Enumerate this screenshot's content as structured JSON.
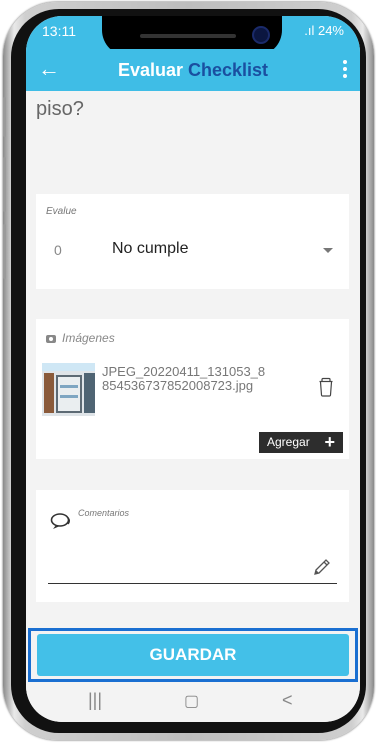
{
  "status": {
    "time": "13:11",
    "signal": ".ıl",
    "battery": "24%"
  },
  "appbar": {
    "title_part1": "Evaluar",
    "title_part2": "Checklist"
  },
  "question": {
    "text": "piso?"
  },
  "evaluation": {
    "label": "Evalue",
    "score": "0",
    "value": "No cumple"
  },
  "images": {
    "header": "Imágenes",
    "file_name": "JPEG_20220411_131053_8854536737852008723.jpg",
    "add_label": "Agregar"
  },
  "comments": {
    "label": "Comentarios",
    "value": ""
  },
  "actions": {
    "save_label": "GUARDAR"
  },
  "navbar": {
    "recent": "|||",
    "home": "▢",
    "back": "<"
  },
  "colors": {
    "accent": "#3fbde6",
    "title_secondary": "#1a4fa0",
    "save_outline": "#1a6fd1"
  }
}
